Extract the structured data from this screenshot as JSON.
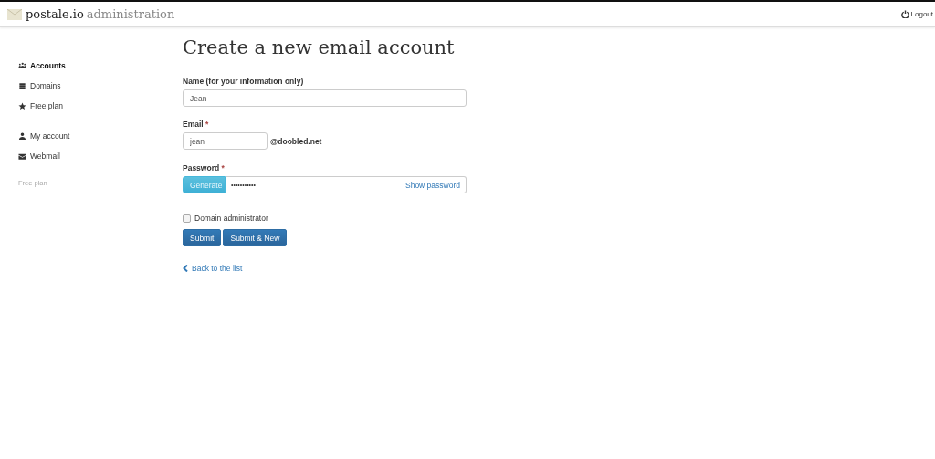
{
  "header": {
    "brand": "postale.io",
    "subtitle": "administration",
    "logout": "Logout"
  },
  "sidebar": {
    "groups": [
      [
        {
          "label": "Accounts",
          "selected": true
        },
        {
          "label": "Domains",
          "selected": false
        },
        {
          "label": "Free plan",
          "selected": false
        }
      ],
      [
        {
          "label": "My account",
          "selected": false
        },
        {
          "label": "Webmail",
          "selected": false
        }
      ]
    ],
    "footer": "Free plan"
  },
  "form": {
    "title": "Create a new email account",
    "name": {
      "label": "Name (for your information only)",
      "value": "Jean"
    },
    "email": {
      "label": "Email",
      "required": "*",
      "value": "jean",
      "domain": "@doobled.net"
    },
    "password": {
      "label": "Password",
      "required": "*",
      "generate": "Generate",
      "value": "•••••••••••",
      "show": "Show password"
    },
    "domain_admin": {
      "label": "Domain administrator",
      "checked": false
    },
    "buttons": [
      "Submit",
      "Submit & New"
    ],
    "back": "Back to the list"
  }
}
